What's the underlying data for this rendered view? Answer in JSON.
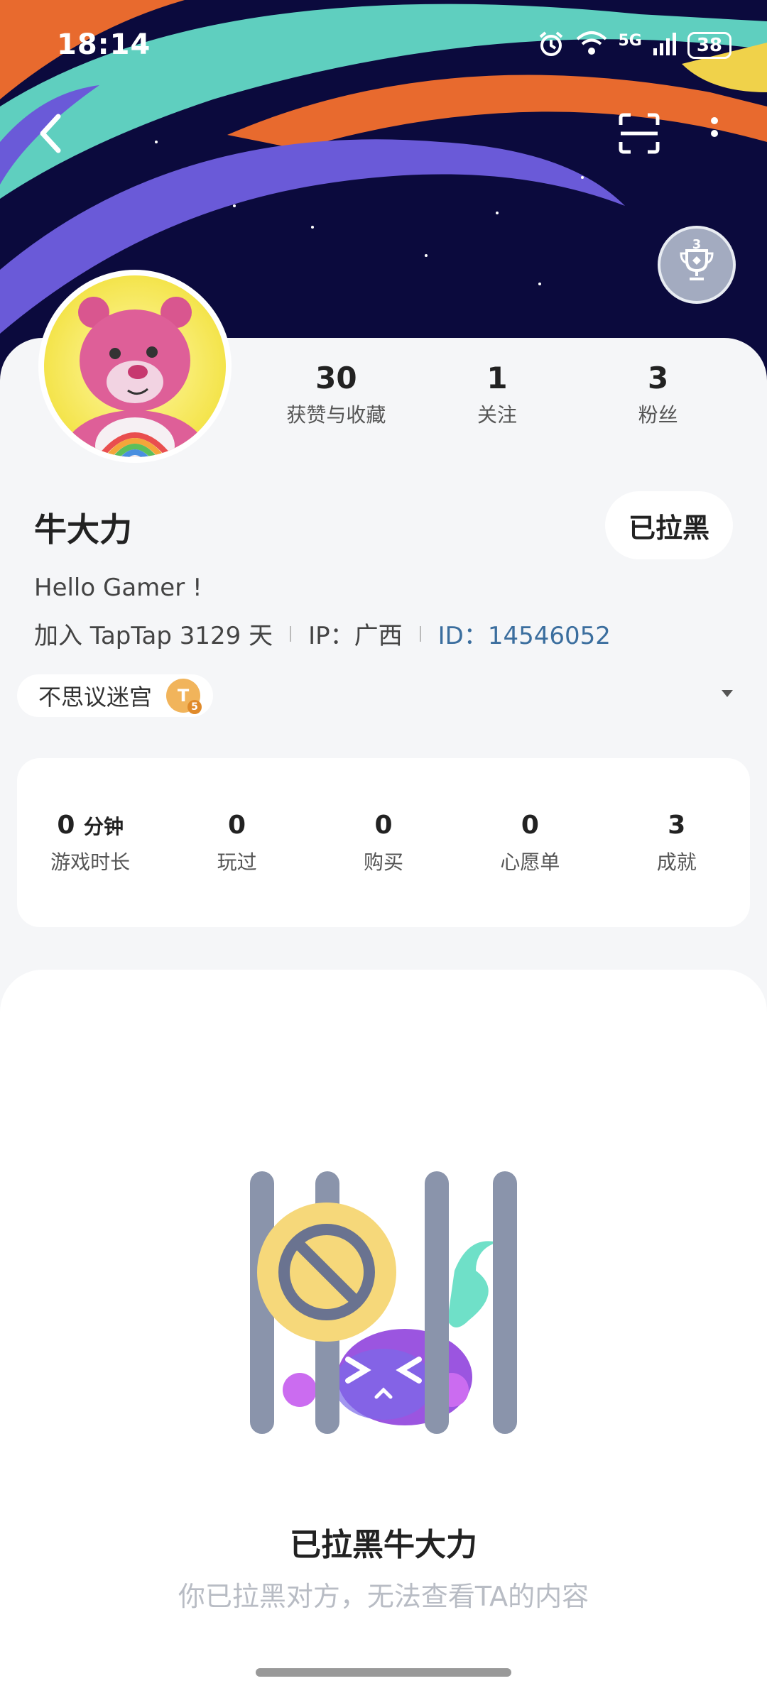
{
  "status_bar": {
    "time": "18:14",
    "network": "5G",
    "battery": "38"
  },
  "header": {
    "back_icon": "chevron-left-icon",
    "scan_icon": "scan-icon",
    "more_icon": "more-vertical-icon",
    "trophy_badge_count": "3"
  },
  "profile": {
    "name": "牛大力",
    "bio": "Hello Gamer !",
    "joined": "加入 TapTap 3129 天",
    "ip": "IP：广西",
    "id": "ID：14546052",
    "blocked_button": "已拉黑",
    "game_tag": "不思议迷宫",
    "game_tag_badge": "T",
    "game_tag_level": "5"
  },
  "social_stats": [
    {
      "value": "30",
      "label": "获赞与收藏"
    },
    {
      "value": "1",
      "label": "关注"
    },
    {
      "value": "3",
      "label": "粉丝"
    }
  ],
  "game_stats": {
    "playtime_value": "0",
    "playtime_unit": "分钟",
    "playtime_label": "游戏时长",
    "items": [
      {
        "value": "0",
        "label": "玩过"
      },
      {
        "value": "0",
        "label": "购买"
      },
      {
        "value": "0",
        "label": "心愿单"
      },
      {
        "value": "3",
        "label": "成就"
      }
    ]
  },
  "empty_state": {
    "title": "已拉黑牛大力",
    "subtitle": "你已拉黑对方，无法查看TA的内容"
  },
  "colors": {
    "banner_bg": "#0b0a3d",
    "accent_id": "#3b6e9e",
    "stripe_orange": "#e86a2e",
    "stripe_teal": "#5fcfbf",
    "stripe_purple": "#6a5ad8"
  }
}
